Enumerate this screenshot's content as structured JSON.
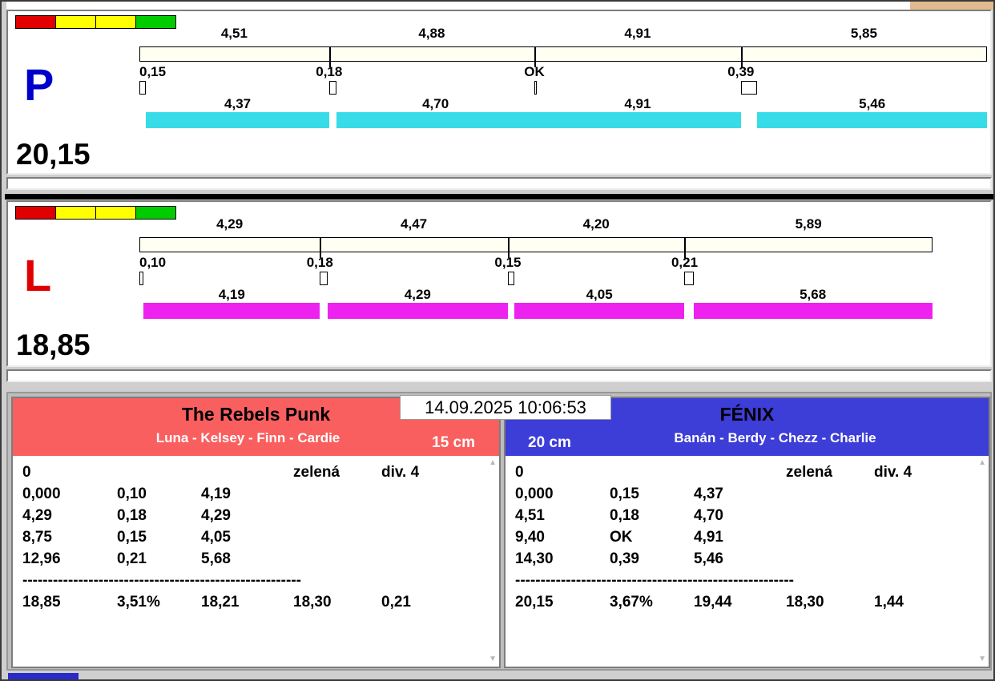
{
  "window": {
    "timestamp": "14.09.2025 10:06:53"
  },
  "colors": {
    "gross_bar": "#fffff2",
    "lane_p_bar": "#38dce8",
    "lane_l_bar": "#ee22ee"
  },
  "lanes": [
    {
      "id": "P",
      "letter": "P",
      "letter_color": "#0000cc",
      "total": "20,15",
      "bar_color": "#38dce8",
      "lights": [
        "#e00000",
        "#ffff00",
        "#ffff00",
        "#00cc00"
      ],
      "segments": [
        {
          "gross": "4,51",
          "change": "0,15",
          "net": "4,37"
        },
        {
          "gross": "4,88",
          "change": "0,18",
          "net": "4,70"
        },
        {
          "gross": "4,91",
          "change": "OK",
          "net": "4,91"
        },
        {
          "gross": "5,85",
          "change": "0,39",
          "net": "5,46"
        }
      ]
    },
    {
      "id": "L",
      "letter": "L",
      "letter_color": "#e00000",
      "total": "18,85",
      "bar_color": "#ee22ee",
      "lights": [
        "#e00000",
        "#ffff00",
        "#ffff00",
        "#00cc00"
      ],
      "segments": [
        {
          "gross": "4,29",
          "change": "0,10",
          "net": "4,19"
        },
        {
          "gross": "4,47",
          "change": "0,18",
          "net": "4,29"
        },
        {
          "gross": "4,20",
          "change": "0,15",
          "net": "4,05"
        },
        {
          "gross": "5,89",
          "change": "0,21",
          "net": "5,68"
        }
      ]
    }
  ],
  "teams": [
    {
      "name": "The Rebels Punk",
      "members": "Luna - Kelsey - Finn - Cardie",
      "height": "15 cm",
      "header_color": "#fa5f5f",
      "info": {
        "start": "0",
        "color": "zelená",
        "division": "div. 4"
      },
      "rows": [
        [
          "0,000",
          "0,10",
          "4,19"
        ],
        [
          "4,29",
          "0,18",
          "4,29"
        ],
        [
          "8,75",
          "0,15",
          "4,05"
        ],
        [
          "12,96",
          "0,21",
          "5,68"
        ]
      ],
      "separator": "-------------------------------------------------------",
      "totals": [
        "18,85",
        "3,51%",
        "18,21",
        "18,30",
        "0,21"
      ]
    },
    {
      "name": "FÉNIX",
      "members": "Banán - Berdy - Chezz - Charlie",
      "height": "20 cm",
      "header_color": "#3d3dd8",
      "info": {
        "start": "0",
        "color": "zelená",
        "division": "div. 4"
      },
      "rows": [
        [
          "0,000",
          "0,15",
          "4,37"
        ],
        [
          "4,51",
          "0,18",
          "4,70"
        ],
        [
          "9,40",
          "OK",
          "4,91"
        ],
        [
          "14,30",
          "0,39",
          "5,46"
        ]
      ],
      "separator": "-------------------------------------------------------",
      "totals": [
        "20,15",
        "3,67%",
        "19,44",
        "18,30",
        "1,44"
      ]
    }
  ]
}
